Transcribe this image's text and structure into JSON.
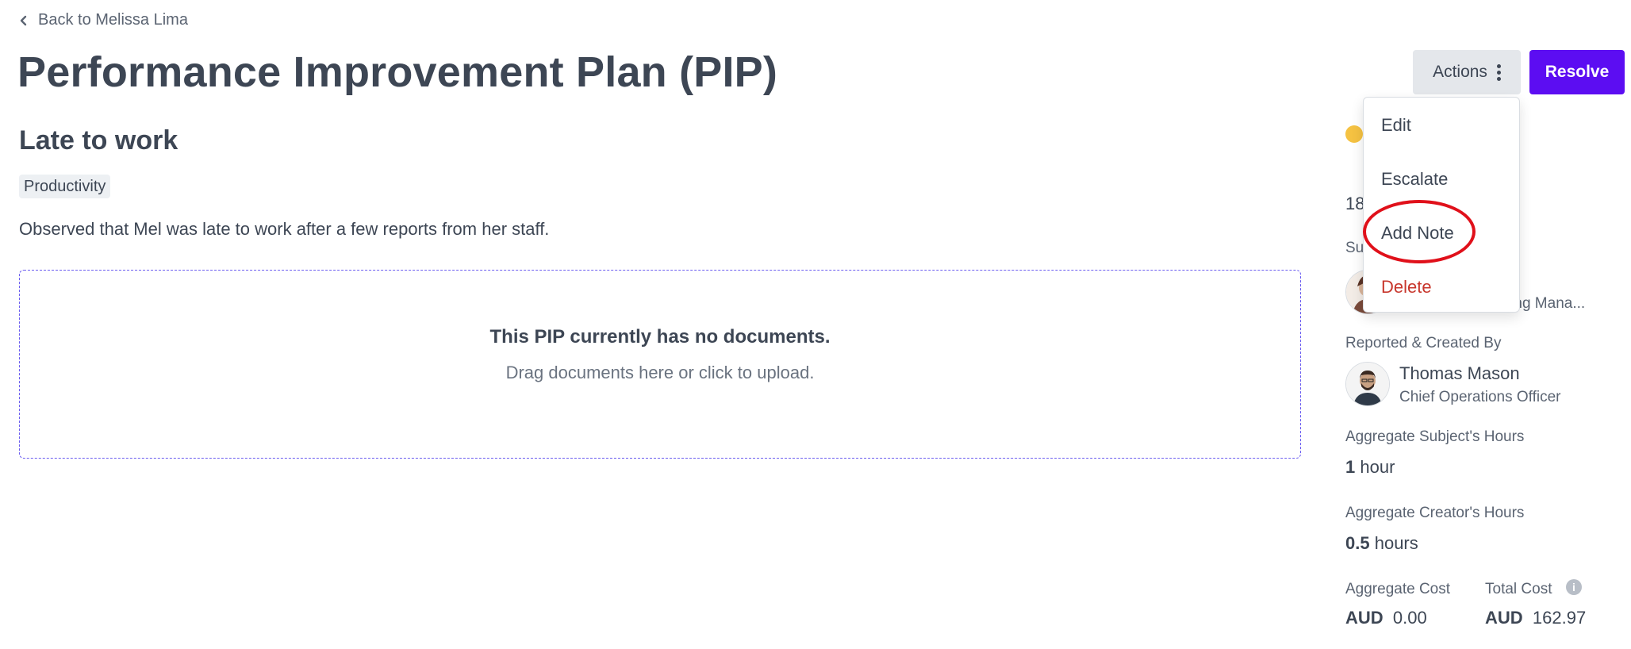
{
  "header": {
    "back_label": "Back to Melissa Lima",
    "title": "Performance Improvement Plan (PIP)",
    "actions_label": "Actions",
    "resolve_label": "Resolve"
  },
  "issue": {
    "title": "Late to work",
    "tag": "Productivity",
    "description": "Observed that Mel was late to work after a few reports from her staff."
  },
  "documents": {
    "empty_title": "This PIP currently has no documents.",
    "empty_hint": "Drag documents here or click to upload."
  },
  "actions_menu": {
    "items": [
      "Edit",
      "Escalate",
      "Add Note",
      "Delete"
    ],
    "highlighted_item": "Add Note"
  },
  "sidebar": {
    "status_color": "#f5c242",
    "date_partial": "18",
    "subject_label_partial": "Su",
    "subject_role_partial": "rating Mana...",
    "reported_label": "Reported & Created By",
    "reporter": {
      "name": "Thomas Mason",
      "role": "Chief Operations Officer"
    },
    "subject_hours_label": "Aggregate Subject's Hours",
    "subject_hours_value": "1",
    "subject_hours_unit": "hour",
    "creator_hours_label": "Aggregate Creator's Hours",
    "creator_hours_value": "0.5",
    "creator_hours_unit": "hours",
    "aggregate_cost_label": "Aggregate Cost",
    "aggregate_cost_currency": "AUD",
    "aggregate_cost_value": "0.00",
    "total_cost_label": "Total Cost",
    "total_cost_currency": "AUD",
    "total_cost_value": "162.97"
  },
  "colors": {
    "accent": "#5c0df2",
    "danger": "#c8372d",
    "highlight": "#e0101a",
    "dropzone_border": "#6a5cf0"
  },
  "icons": [
    "chevron-left-icon",
    "kebab-icon",
    "info-icon"
  ]
}
